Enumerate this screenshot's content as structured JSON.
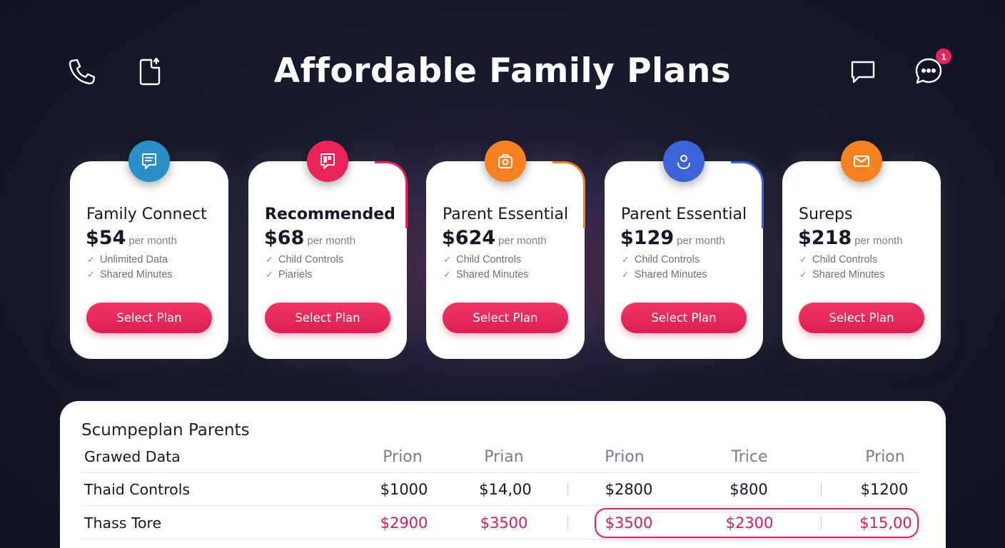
{
  "header": {
    "title": "Affordable Family Plans",
    "notification_count": "1",
    "icons": [
      "phone-icon",
      "document-icon",
      "message-icon",
      "chat-icon"
    ]
  },
  "plans": [
    {
      "name": "Family Connect",
      "price": "$54",
      "period": "per month",
      "features": [
        "Unlimited Data",
        "Shared Minutes"
      ],
      "button": "Select Plan",
      "icon": "message-list-icon",
      "color": "#2a8fc9"
    },
    {
      "name": "Recommended",
      "price": "$68",
      "period": "per month",
      "features": [
        "Child Controls",
        "Piariels"
      ],
      "button": "Select Plan",
      "icon": "chat-grid-icon",
      "color": "#e8245a"
    },
    {
      "name": "Parent Essential",
      "price": "$624",
      "period": "per month",
      "features": [
        "Child Controls",
        "Shared Minutes"
      ],
      "button": "Select Plan",
      "icon": "camera-icon",
      "color": "#f5821f"
    },
    {
      "name": "Parent Essential",
      "price": "$129",
      "period": "per month",
      "features": [
        "Child Controls",
        "Shared Minutes"
      ],
      "button": "Select Plan",
      "icon": "user-circle-icon",
      "color": "#3d63d8"
    },
    {
      "name": "Sureps",
      "price": "$218",
      "period": "per month",
      "features": [
        "Child Controls",
        "Shared Minutes"
      ],
      "button": "Select Plan",
      "icon": "envelope-icon",
      "color": "#f5821f"
    }
  ],
  "comparison": {
    "title": "Scumpeplan Parents",
    "header": {
      "label": "Grawed Data",
      "cols": [
        "Prion",
        "Prian",
        "Prion",
        "Trice",
        "Prion"
      ]
    },
    "rows": [
      {
        "label": "Thaid Controls",
        "values": [
          "$1000",
          "$14,00",
          "$2800",
          "$800",
          "$1200"
        ]
      },
      {
        "label": "Thass Tore",
        "values": [
          "$2900",
          "$3500",
          "$3500",
          "$2300",
          "$15,00"
        ]
      }
    ]
  }
}
